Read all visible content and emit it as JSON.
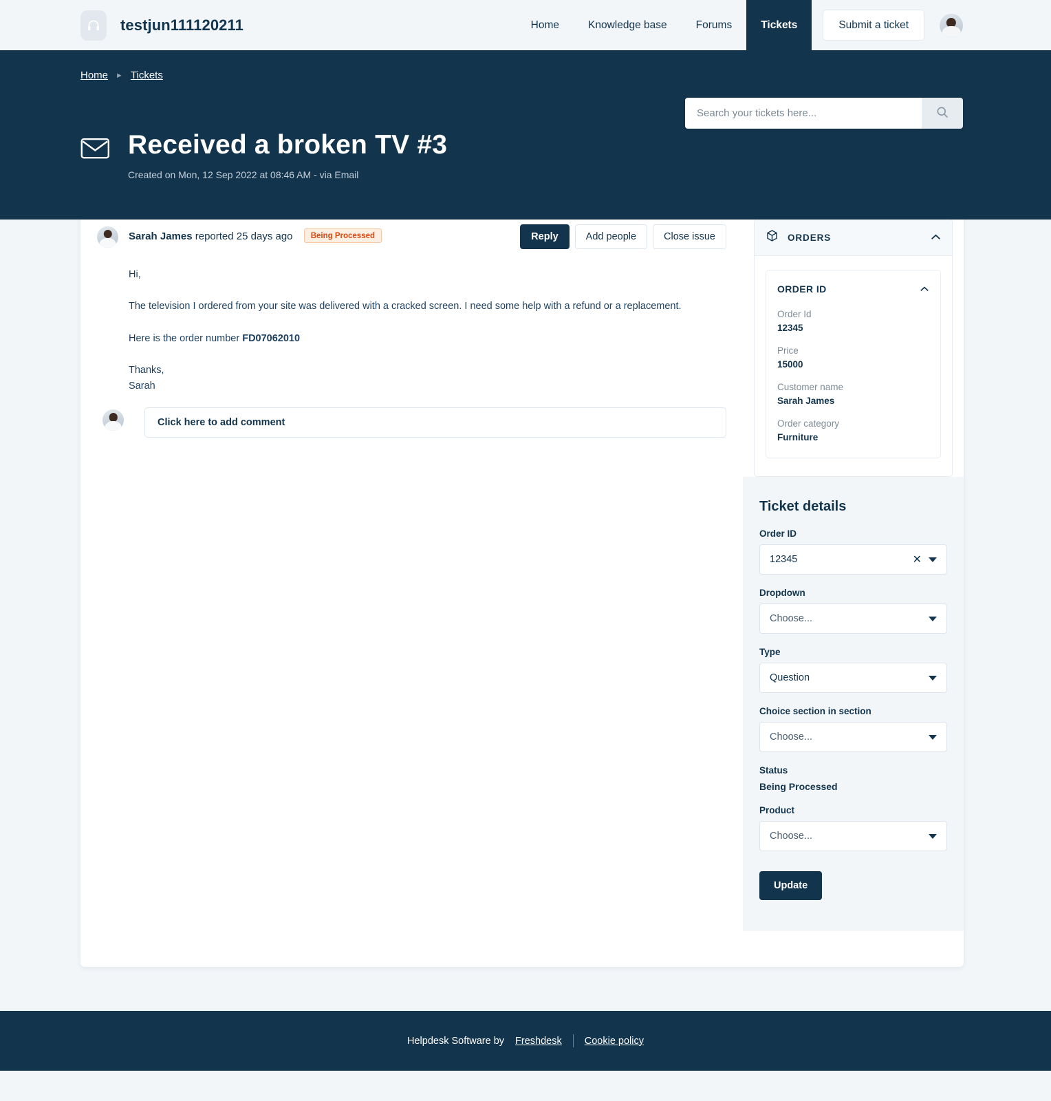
{
  "header": {
    "brand_name": "testjun111120211",
    "logo_icon": "headset-icon",
    "nav": [
      {
        "label": "Home",
        "active": false
      },
      {
        "label": "Knowledge base",
        "active": false
      },
      {
        "label": "Forums",
        "active": false
      },
      {
        "label": "Tickets",
        "active": true
      }
    ],
    "submit_label": "Submit a ticket",
    "avatar_icon": "user-avatar"
  },
  "breadcrumb": {
    "home": "Home",
    "current": "Tickets",
    "separator": "▶"
  },
  "search": {
    "placeholder": "Search your tickets here...",
    "value": "",
    "icon": "search-icon"
  },
  "ticket": {
    "icon": "envelope-icon",
    "title": "Received a broken TV #3",
    "meta": "Created on Mon, 12 Sep 2022 at 08:46 AM - via Email"
  },
  "conversation": {
    "reporter_name": "Sarah James",
    "reported_text": "reported 25 days ago",
    "status_badge": "Being Processed",
    "buttons": {
      "reply": "Reply",
      "add_people": "Add people",
      "close_issue": "Close issue"
    },
    "message": {
      "greeting": "Hi,",
      "body": "The television I ordered from your site was delivered with a cracked screen. I need some help with a refund or a replacement.",
      "order_line_prefix": "Here is the order number ",
      "order_number": "FD07062010",
      "signoff": "Thanks,",
      "signature": "Sarah"
    },
    "comment_placeholder": "Click here to add comment"
  },
  "orders_panel": {
    "title": "ORDERS",
    "icon": "package-icon",
    "collapse_icon": "chevron-up-icon",
    "order_card": {
      "title": "ORDER ID",
      "collapse_icon": "chevron-up-icon",
      "fields": [
        {
          "label": "Order Id",
          "value": "12345"
        },
        {
          "label": "Price",
          "value": "15000"
        },
        {
          "label": "Customer name",
          "value": "Sarah James"
        },
        {
          "label": "Order category",
          "value": "Furniture"
        }
      ]
    }
  },
  "ticket_details": {
    "title": "Ticket details",
    "fields": [
      {
        "label": "Order ID",
        "type": "select",
        "value": "12345",
        "clearable": true
      },
      {
        "label": "Dropdown",
        "type": "select",
        "value": "Choose...",
        "placeholder": true
      },
      {
        "label": "Type",
        "type": "select",
        "value": "Question"
      },
      {
        "label": "Choice section in section",
        "type": "select",
        "value": "Choose...",
        "placeholder": true
      },
      {
        "label": "Status",
        "type": "text",
        "value": "Being Processed"
      },
      {
        "label": "Product",
        "type": "select",
        "value": "Choose...",
        "placeholder": true
      }
    ],
    "update_label": "Update"
  },
  "footer": {
    "text": "Helpdesk Software by",
    "brand_link": "Freshdesk",
    "cookie_link": "Cookie policy"
  },
  "colors": {
    "navy": "#12344d",
    "page_bg": "#f2f6f9",
    "badge_text": "#d9480f",
    "badge_bg": "#fdeee2"
  }
}
